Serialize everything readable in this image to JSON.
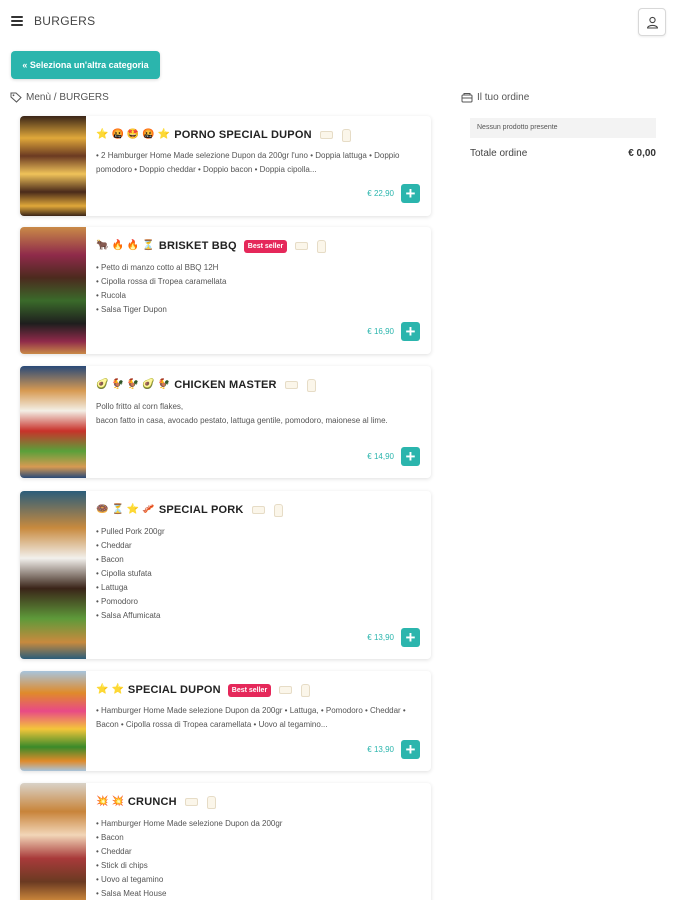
{
  "header": {
    "menu_icon": "hamburger-menu-icon",
    "title": "BURGERS",
    "user_icon": "user-icon"
  },
  "category_button": {
    "icon": "double-chevron-left-icon",
    "label": "« Seleziona un'altra categoria"
  },
  "breadcrumb": {
    "icon": "tag-icon",
    "text": "Menù / BURGERS"
  },
  "products": [
    {
      "name": "PORNO SPECIAL DUPON",
      "emojis": [
        "⭐",
        "🤬",
        "🤩",
        "🤬",
        "⭐"
      ],
      "badge": "",
      "description": "• 2 Hamburger Home Made selezione Dupon da 200gr l'uno • Doppia lattuga • Doppio pomodoro • Doppio cheddar • Doppio bacon • Doppia cipolla...",
      "price": "€ 22,90",
      "add_icon": "plus-icon",
      "allergen_icons": [
        "bread-icon",
        "drink-icon"
      ],
      "photo_colors": [
        "#3a2518",
        "#e0a83a",
        "#6b3a22",
        "#f0c35a",
        "#4a2a1a"
      ]
    },
    {
      "name": "BRISKET BBQ",
      "emojis": [
        "🐂",
        "🔥",
        "🔥",
        "⏳"
      ],
      "badge": "Best seller",
      "description": "• Petto di manzo cotto al BBQ 12H\n• Cipolla rossa di Tropea caramellata\n• Rucola\n• Salsa Tiger Dupon",
      "price": "€ 16,90",
      "add_icon": "plus-icon",
      "allergen_icons": [
        "bread-icon",
        "drink-icon"
      ],
      "photo_colors": [
        "#c98a48",
        "#8f2a4a",
        "#4c2a1e",
        "#3a6a2a",
        "#1e1e1e"
      ]
    },
    {
      "name": "CHICKEN MASTER",
      "emojis": [
        "🥑",
        "🐓",
        "🐓",
        "🥑",
        "🐓"
      ],
      "badge": "",
      "description": "Pollo fritto al corn flakes,\nbacon fatto in casa, avocado pestato, lattuga gentile, pomodoro, maionese al lime.",
      "price": "€ 14,90",
      "add_icon": "plus-icon",
      "allergen_icons": [
        "bread-icon",
        "drink-icon"
      ],
      "photo_colors": [
        "#2a4a78",
        "#d79a52",
        "#f3efe6",
        "#c8322a",
        "#5aa03a"
      ]
    },
    {
      "name": "SPECIAL PORK",
      "emojis": [
        "🍩",
        "⏳",
        "⭐",
        "🥓"
      ],
      "badge": "",
      "description": "• Pulled Pork 200gr\n• Cheddar\n• Bacon\n• Cipolla stufata\n• Lattuga\n• Pomodoro\n• Salsa Affumicata",
      "price": "€ 13,90",
      "add_icon": "plus-icon",
      "allergen_icons": [
        "bread-icon",
        "drink-icon"
      ],
      "photo_colors": [
        "#2b5d7a",
        "#c88a3e",
        "#f2f0ec",
        "#3a2418",
        "#5e9a3a"
      ]
    },
    {
      "name": "SPECIAL DUPON",
      "emojis": [
        "⭐",
        "⭐"
      ],
      "badge": "Best seller",
      "description": "• Hamburger Home Made selezione Dupon da 200gr • Lattuga, • Pomodoro • Cheddar • Bacon • Cipolla rossa di Tropea caramellata • Uovo al tegamino...",
      "price": "€ 13,90",
      "add_icon": "plus-icon",
      "allergen_icons": [
        "bread-icon",
        "drink-icon"
      ],
      "photo_colors": [
        "#a8c4dc",
        "#e08a2a",
        "#e84a86",
        "#f4c63a",
        "#3a8a2a"
      ]
    },
    {
      "name": "CRUNCH",
      "emojis": [
        "💥",
        "💥"
      ],
      "badge": "",
      "description": "• Hamburger Home Made selezione Dupon da 200gr\n• Bacon\n• Cheddar\n• Stick di chips\n• Uovo al tegamino\n• Salsa Meat House",
      "price": "",
      "add_icon": "plus-icon",
      "allergen_icons": [
        "bread-icon",
        "drink-icon"
      ],
      "photo_colors": [
        "#d9d2c8",
        "#c8843a",
        "#f2d6b8",
        "#a83a3a",
        "#6a3a22"
      ]
    }
  ],
  "order": {
    "icon": "cart-icon",
    "heading": "Il tuo ordine",
    "empty_text": "Nessun prodotto presente",
    "total_label": "Totale ordine",
    "total_value": "€ 0,00"
  },
  "colors": {
    "accent": "#2bb5ad",
    "badge": "#e5285a"
  }
}
